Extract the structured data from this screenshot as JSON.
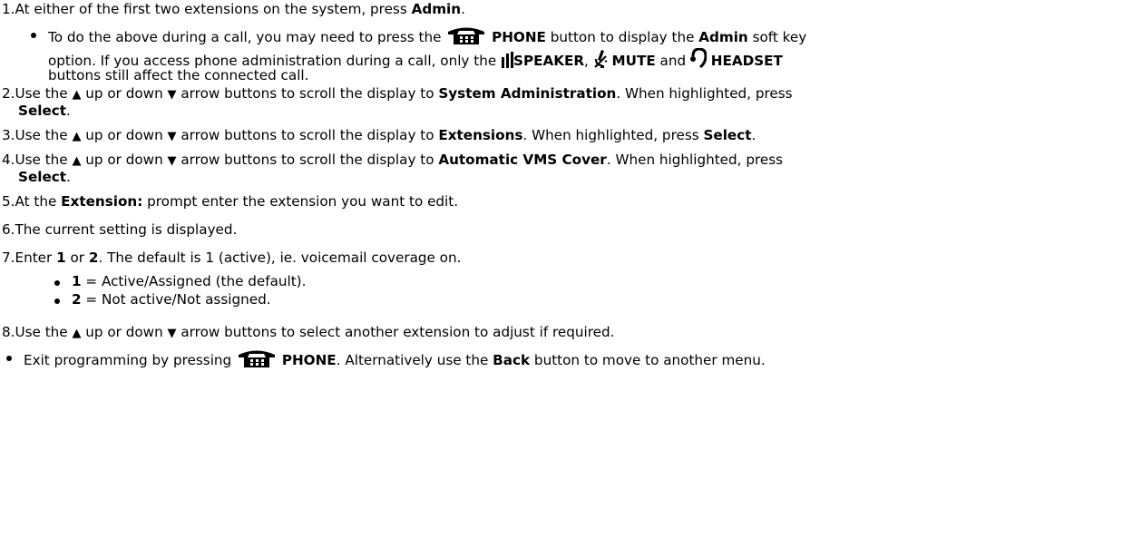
{
  "steps": {
    "s1": {
      "num": "1.",
      "pre": "At either of the first two extensions on the system, press ",
      "b1": "Admin",
      "post": "."
    },
    "s1_sub": {
      "l1_pre": "To do the above during a call, you may need to press the ",
      "l1_phone": "PHONE",
      "l1_mid": " button to display the ",
      "l1_admin": "Admin",
      "l1_post": " soft key",
      "l2_pre": "option. If you access phone administration during a call, only the ",
      "l2_speaker": "SPEAKER",
      "l2_c1": ", ",
      "l2_mute": "MUTE",
      "l2_and": " and ",
      "l2_headset": "HEADSET",
      "l3": "buttons still affect the connected call."
    },
    "s2": {
      "num": "2.",
      "pre": "Use the ",
      "mid": " up or down ",
      "post": " arrow buttons to scroll the display to ",
      "b1": "System Administration",
      "post2": ". When highlighted, press",
      "cont_b": "Select",
      "cont_post": "."
    },
    "s3": {
      "num": "3.",
      "pre": "Use the ",
      "mid": " up or down ",
      "post": " arrow buttons to scroll the display to ",
      "b1": "Extensions",
      "post2": ". When highlighted, press ",
      "b2": "Select",
      "post3": "."
    },
    "s4": {
      "num": "4.",
      "pre": "Use the ",
      "mid": " up or down ",
      "post": " arrow buttons to scroll the display to ",
      "b1": "Automatic VMS Cover",
      "post2": ". When highlighted, press",
      "cont_b": "Select",
      "cont_post": "."
    },
    "s5": {
      "num": "5.",
      "pre": "At the ",
      "b1": "Extension:",
      "post": " prompt enter the extension you want to edit."
    },
    "s6": {
      "num": "6.",
      "text": "The current setting is displayed."
    },
    "s7": {
      "num": "7.",
      "pre": "Enter ",
      "b1": "1",
      "mid": " or ",
      "b2": "2",
      "post": ".  The default is 1 (active), ie. voicemail coverage on."
    },
    "s7_opts": [
      {
        "b": "1",
        "text": " = Active/Assigned (the default)."
      },
      {
        "b": "2",
        "text": " = Not active/Not assigned."
      }
    ],
    "s8": {
      "num": "8.",
      "pre": "Use the ",
      "mid": " up or down ",
      "post": " arrow buttons to select another extension to adjust if required."
    },
    "exit": {
      "pre": "Exit programming by pressing ",
      "b1": "PHONE",
      "mid": ". Alternatively use the ",
      "b2": "Back",
      "post": " button to move to another menu."
    }
  },
  "icons": {
    "phone": "phone-icon",
    "speaker": "speaker-icon",
    "mute": "mute-icon",
    "headset": "headset-icon",
    "up": "up-arrow-icon",
    "down": "down-arrow-icon"
  },
  "glyphs": {
    "up": "▲",
    "down": "▼"
  }
}
